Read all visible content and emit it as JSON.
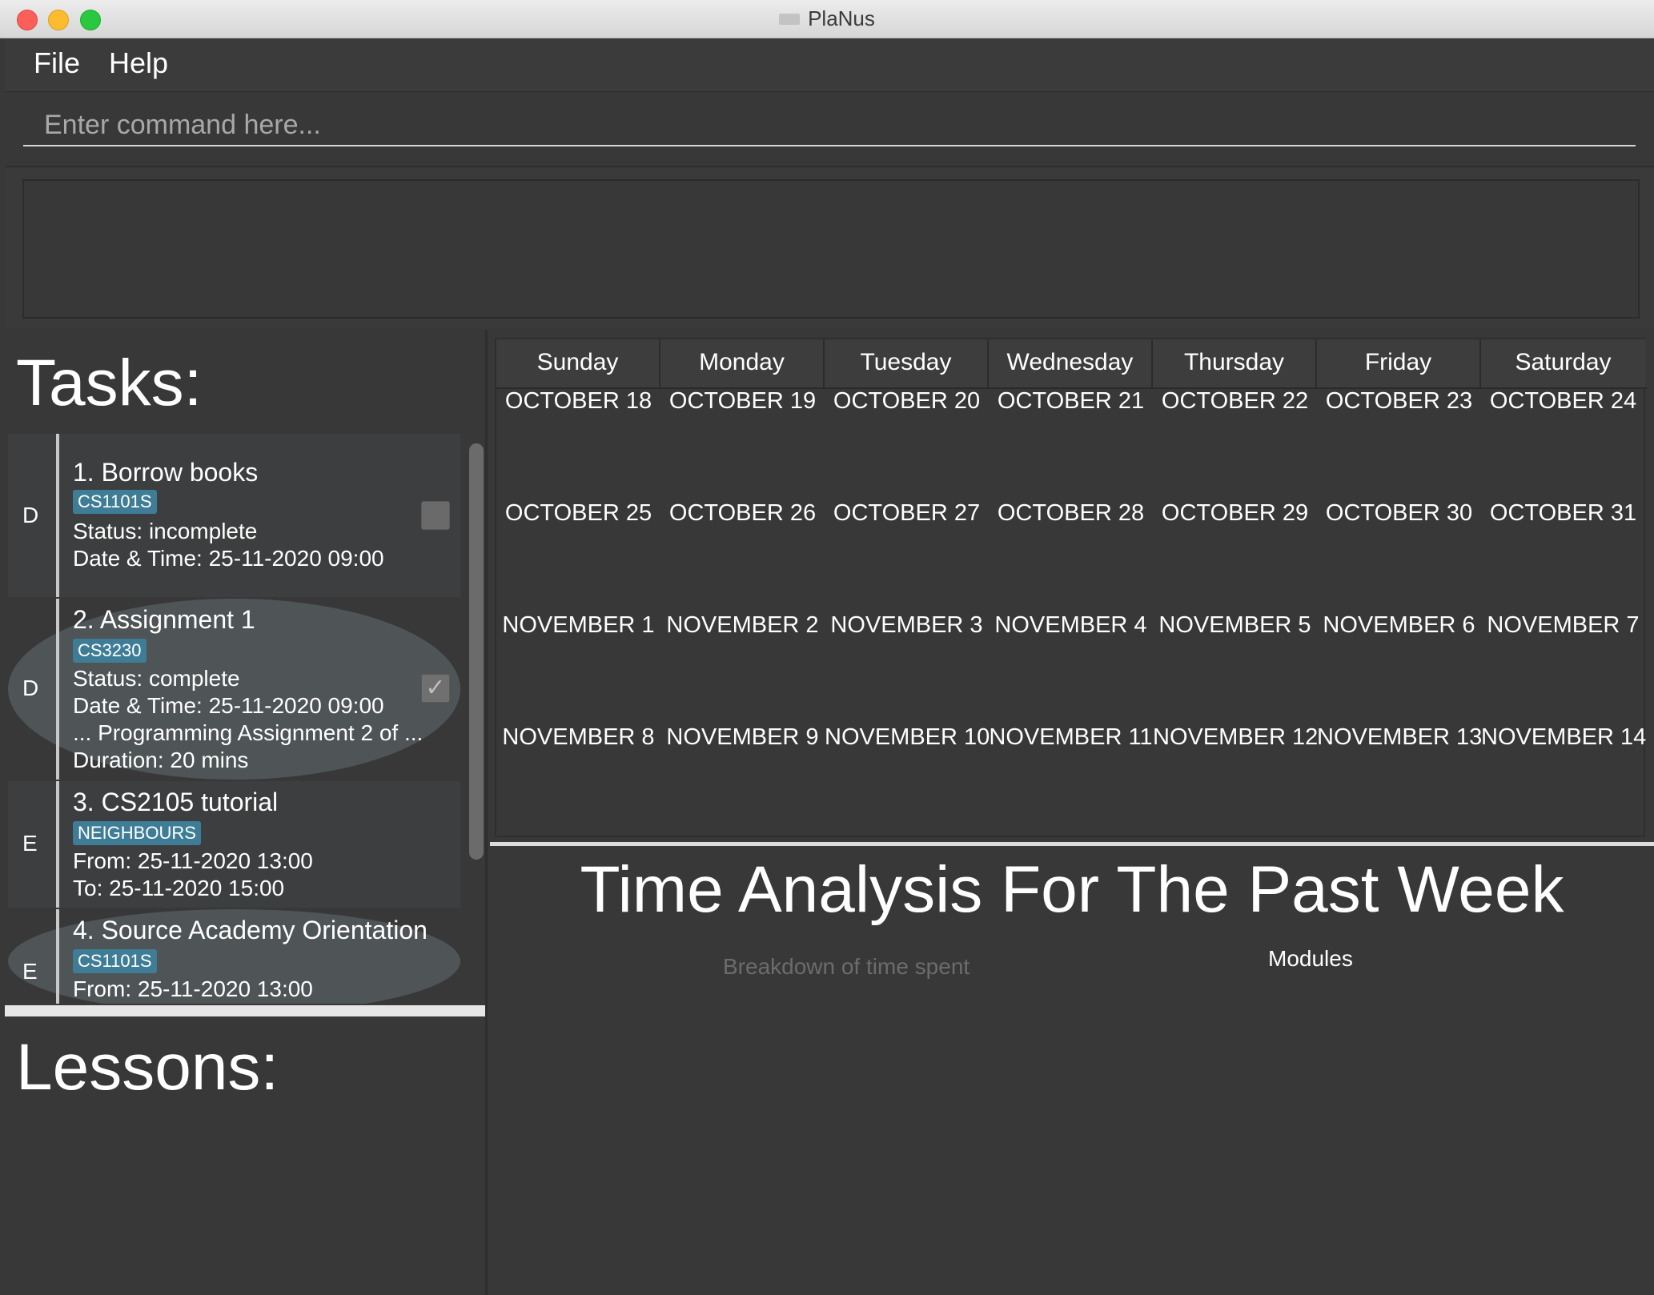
{
  "window": {
    "title": "PlaNus"
  },
  "menu": {
    "file": "File",
    "help": "Help"
  },
  "command": {
    "placeholder": "Enter command here..."
  },
  "tasks": {
    "title": "Tasks:",
    "items": [
      {
        "type": "D",
        "name": "1.  Borrow books",
        "tag": "CS1101S",
        "fields": [
          "Status:  incomplete",
          "Date & Time:  25-11-2020 09:00"
        ],
        "checked": false
      },
      {
        "type": "D",
        "name": "2.  Assignment 1",
        "tag": "CS3230",
        "fields": [
          "Status:  complete",
          "Date & Time:  25-11-2020 09:00",
          "... Programming Assignment 2 of ...",
          "Duration:  20 mins"
        ],
        "checked": true
      },
      {
        "type": "E",
        "name": "3.  CS2105 tutorial",
        "tag": "NEIGHBOURS",
        "fields": [
          "From:  25-11-2020 13:00",
          "To:  25-11-2020 15:00"
        ]
      },
      {
        "type": "E",
        "name": "4.  Source Academy Orientation",
        "tag": "CS1101S",
        "fields": [
          "From:  25-11-2020 13:00"
        ]
      }
    ]
  },
  "lessons": {
    "title": "Lessons:"
  },
  "calendar": {
    "days": [
      "Sunday",
      "Monday",
      "Tuesday",
      "Wednesday",
      "Thursday",
      "Friday",
      "Saturday"
    ],
    "weeks": [
      [
        "OCTOBER 18",
        "OCTOBER 19",
        "OCTOBER 20",
        "OCTOBER 21",
        "OCTOBER 22",
        "OCTOBER 23",
        "OCTOBER 24"
      ],
      [
        "OCTOBER 25",
        "OCTOBER 26",
        "OCTOBER 27",
        "OCTOBER 28",
        "OCTOBER 29",
        "OCTOBER 30",
        "OCTOBER 31"
      ],
      [
        "NOVEMBER 1",
        "NOVEMBER 2",
        "NOVEMBER 3",
        "NOVEMBER 4",
        "NOVEMBER 5",
        "NOVEMBER 6",
        "NOVEMBER 7"
      ],
      [
        "NOVEMBER 8",
        "NOVEMBER 9",
        "NOVEMBER 10",
        "NOVEMBER 11",
        "NOVEMBER 12",
        "NOVEMBER 13",
        "NOVEMBER 14"
      ]
    ]
  },
  "analysis": {
    "title": "Time Analysis For The Past Week",
    "subtitle": "Breakdown of time spent",
    "legend": "Modules"
  },
  "colors": {
    "tag": "#3f7d97",
    "background": "#383838"
  }
}
